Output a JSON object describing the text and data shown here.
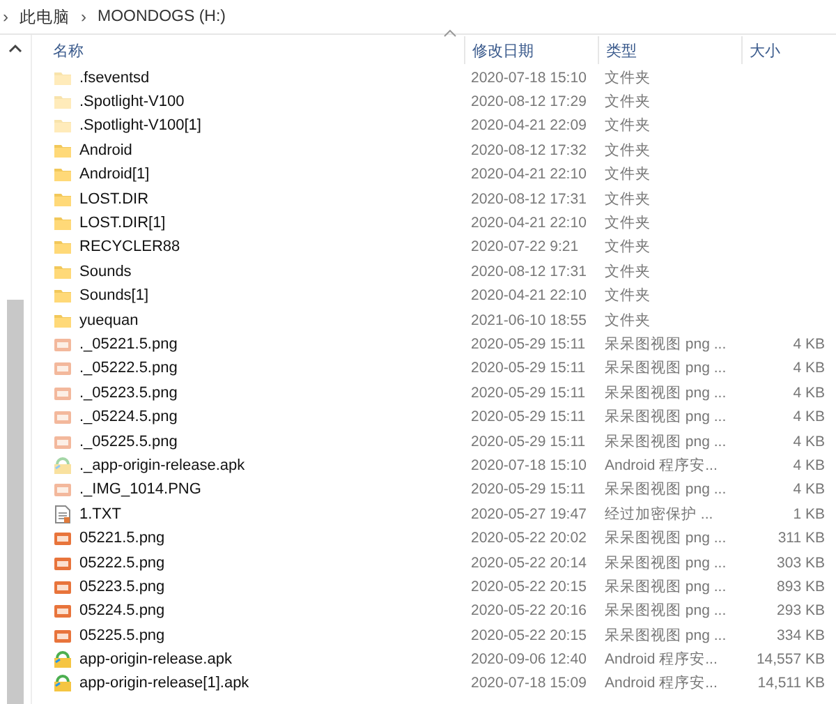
{
  "breadcrumb": [
    {
      "separator": "›",
      "label": "此电脑"
    },
    {
      "separator": "›",
      "label": "MOONDOGS (H:)"
    }
  ],
  "columns": [
    "名称",
    "修改日期",
    "类型",
    "大小"
  ],
  "rows": [
    {
      "kind": "folder",
      "name": ".fseventsd",
      "date": "2020-07-18 15:10",
      "type": "文件夹",
      "hidden": true
    },
    {
      "kind": "folder",
      "name": ".Spotlight-V100",
      "date": "2020-08-12 17:29",
      "type": "文件夹",
      "hidden": true
    },
    {
      "kind": "folder",
      "name": ".Spotlight-V100[1]",
      "date": "2020-04-21 22:09",
      "type": "文件夹",
      "hidden": true
    },
    {
      "kind": "folder",
      "name": "Android",
      "date": "2020-08-12 17:32",
      "type": "文件夹",
      "hidden": false
    },
    {
      "kind": "folder",
      "name": "Android[1]",
      "date": "2020-04-21 22:10",
      "type": "文件夹",
      "hidden": false
    },
    {
      "kind": "folder",
      "name": "LOST.DIR",
      "date": "2020-08-12 17:31",
      "type": "文件夹",
      "hidden": false
    },
    {
      "kind": "folder",
      "name": "LOST.DIR[1]",
      "date": "2020-04-21 22:10",
      "type": "文件夹",
      "hidden": false
    },
    {
      "kind": "folder",
      "name": "RECYCLER88",
      "date": "2020-07-22 9:21",
      "type": "文件夹",
      "hidden": false
    },
    {
      "kind": "folder",
      "name": "Sounds",
      "date": "2020-08-12 17:31",
      "type": "文件夹",
      "hidden": false
    },
    {
      "kind": "folder",
      "name": "Sounds[1]",
      "date": "2020-04-21 22:10",
      "type": "文件夹",
      "hidden": false
    },
    {
      "kind": "folder",
      "name": "yuequan",
      "date": "2021-06-10 18:55",
      "type": "文件夹",
      "hidden": false
    },
    {
      "kind": "image",
      "name": "._05221.5.png",
      "date": "2020-05-29 15:11",
      "type": "呆呆图视图 png ...",
      "size": "4 KB",
      "hidden": true
    },
    {
      "kind": "image",
      "name": "._05222.5.png",
      "date": "2020-05-29 15:11",
      "type": "呆呆图视图 png ...",
      "size": "4 KB",
      "hidden": true
    },
    {
      "kind": "image",
      "name": "._05223.5.png",
      "date": "2020-05-29 15:11",
      "type": "呆呆图视图 png ...",
      "size": "4 KB",
      "hidden": true
    },
    {
      "kind": "image",
      "name": "._05224.5.png",
      "date": "2020-05-29 15:11",
      "type": "呆呆图视图 png ...",
      "size": "4 KB",
      "hidden": true
    },
    {
      "kind": "image",
      "name": "._05225.5.png",
      "date": "2020-05-29 15:11",
      "type": "呆呆图视图 png ...",
      "size": "4 KB",
      "hidden": true
    },
    {
      "kind": "apk",
      "name": "._app-origin-release.apk",
      "date": "2020-07-18 15:10",
      "type": "Android 程序安...",
      "size": "4 KB",
      "hidden": true
    },
    {
      "kind": "image",
      "name": "._IMG_1014.PNG",
      "date": "2020-05-29 15:11",
      "type": "呆呆图视图 png ...",
      "size": "4 KB",
      "hidden": true
    },
    {
      "kind": "text",
      "name": "1.TXT",
      "date": "2020-05-27 19:47",
      "type": "经过加密保护 ...",
      "size": "1 KB",
      "hidden": false
    },
    {
      "kind": "image",
      "name": "05221.5.png",
      "date": "2020-05-22 20:02",
      "type": "呆呆图视图 png ...",
      "size": "311 KB",
      "hidden": false
    },
    {
      "kind": "image",
      "name": "05222.5.png",
      "date": "2020-05-22 20:14",
      "type": "呆呆图视图 png ...",
      "size": "303 KB",
      "hidden": false
    },
    {
      "kind": "image",
      "name": "05223.5.png",
      "date": "2020-05-22 20:15",
      "type": "呆呆图视图 png ...",
      "size": "893 KB",
      "hidden": false
    },
    {
      "kind": "image",
      "name": "05224.5.png",
      "date": "2020-05-22 20:16",
      "type": "呆呆图视图 png ...",
      "size": "293 KB",
      "hidden": false
    },
    {
      "kind": "image",
      "name": "05225.5.png",
      "date": "2020-05-22 20:15",
      "type": "呆呆图视图 png ...",
      "size": "334 KB",
      "hidden": false
    },
    {
      "kind": "apk",
      "name": "app-origin-release.apk",
      "date": "2020-09-06 12:40",
      "type": "Android 程序安...",
      "size": "14,557 KB",
      "hidden": false
    },
    {
      "kind": "apk",
      "name": "app-origin-release[1].apk",
      "date": "2020-07-18 15:09",
      "type": "Android 程序安...",
      "size": "14,511 KB",
      "hidden": false
    }
  ]
}
